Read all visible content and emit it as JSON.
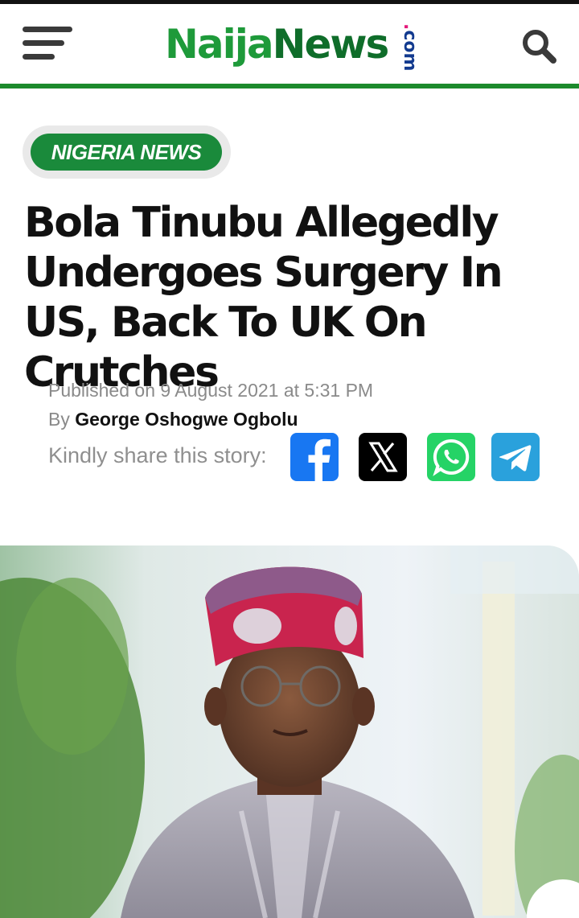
{
  "header": {
    "logo": {
      "part1": "Naija",
      "part2": "News",
      "suffix": "com"
    },
    "menu_icon": "hamburger-menu-icon",
    "search_icon": "search-icon",
    "colors": {
      "brand_green": "#1e9a3a",
      "divider_green": "#1c8a2c"
    }
  },
  "article": {
    "category": "NIGERIA NEWS",
    "title": "Bola Tinubu Allegedly Undergoes Surgery In US, Back To UK On Crutches",
    "published": "Published on 9 August 2021 at 5:31 PM",
    "by_prefix": "By",
    "author": "George Oshogwe Ogbolu",
    "share_label": "Kindly share this story:",
    "share_buttons": [
      {
        "name": "Facebook",
        "icon": "facebook-icon",
        "color": "#1877f2"
      },
      {
        "name": "X",
        "icon": "x-icon",
        "color": "#000000"
      },
      {
        "name": "WhatsApp",
        "icon": "whatsapp-icon",
        "color": "#25d366"
      },
      {
        "name": "Telegram",
        "icon": "telegram-icon",
        "color": "#2aa1dc"
      }
    ]
  }
}
